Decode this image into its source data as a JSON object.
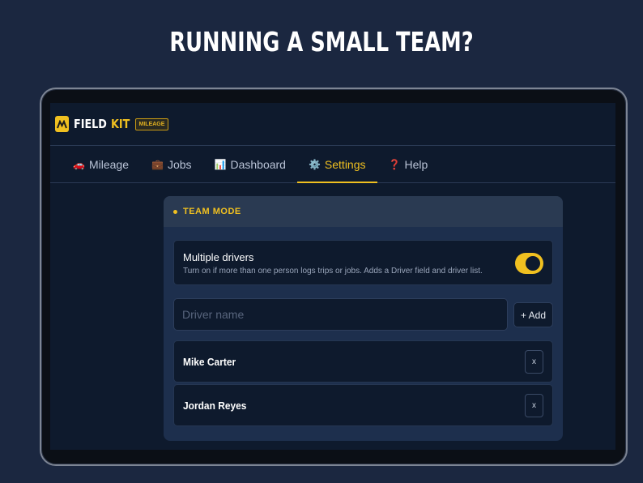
{
  "headline": "RUNNING A SMALL TEAM?",
  "app": {
    "logo_field": "FIELD",
    "logo_kit": "KIT",
    "badge": "MILEAGE"
  },
  "tabs": [
    {
      "icon": "🚗",
      "label": "Mileage",
      "active": false
    },
    {
      "icon": "💼",
      "label": "Jobs",
      "active": false
    },
    {
      "icon": "📊",
      "label": "Dashboard",
      "active": false
    },
    {
      "icon": "⚙️",
      "label": "Settings",
      "active": true
    },
    {
      "icon": "❓",
      "label": "Help",
      "active": false
    }
  ],
  "team_mode": {
    "section_title": "TEAM MODE",
    "toggle_title": "Multiple drivers",
    "toggle_desc": "Turn on if more than one person logs trips or jobs. Adds a Driver field and driver list.",
    "toggle_on": true,
    "input_placeholder": "Driver name",
    "add_label": "+ Add",
    "remove_label": "x",
    "drivers": [
      "Mike Carter",
      "Jordan Reyes"
    ]
  },
  "colors": {
    "accent": "#f0c020",
    "background": "#1b2740",
    "card": "#1d2f4d"
  }
}
